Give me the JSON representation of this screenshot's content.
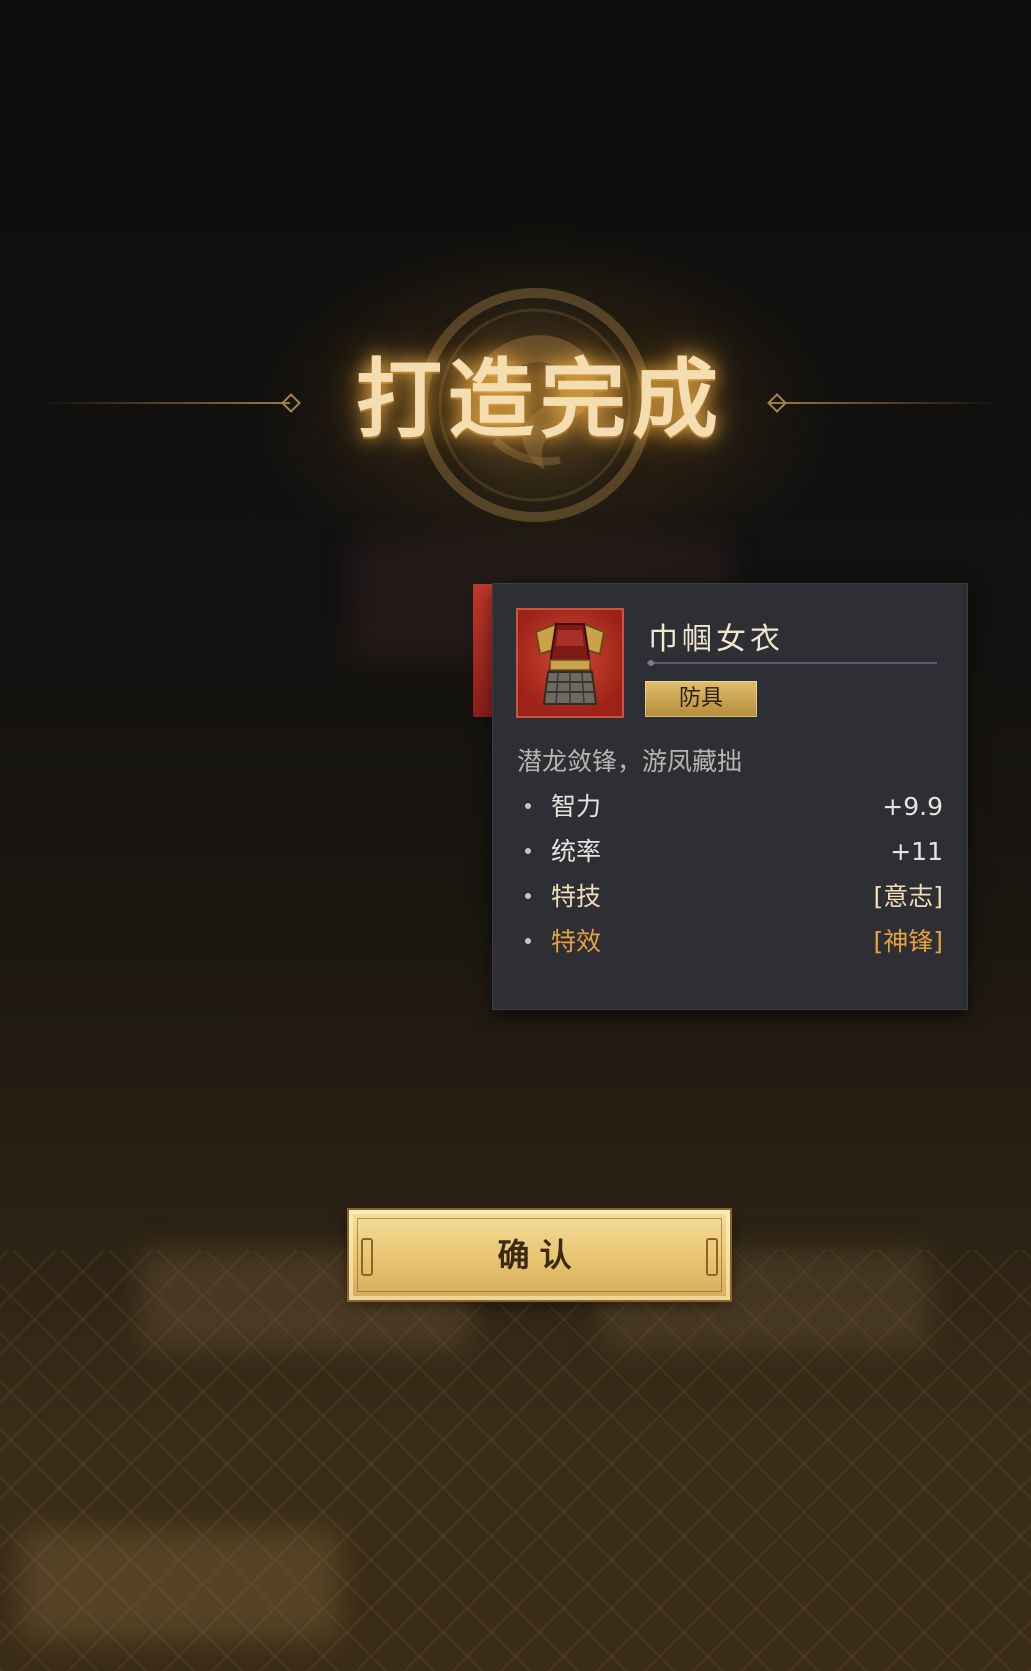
{
  "dialog": {
    "title": "打造完成",
    "confirm_label": "确认"
  },
  "item": {
    "name": "巾帼女衣",
    "type": "防具",
    "flavor": "潜龙敛锋，游凤藏拙",
    "stats": [
      {
        "label": "智力",
        "value": "+9.9"
      },
      {
        "label": "统率",
        "value": "+11"
      },
      {
        "label": "特技",
        "value": "[意志]"
      },
      {
        "label": "特效",
        "value": "[神锋]"
      }
    ]
  },
  "colors": {
    "gold_glow": "#f4ddb0",
    "card_bg": "#2e2f34",
    "rarity_red": "#c2382c",
    "badge_gold": "#d6ab58",
    "effect_orange": "#e5a040"
  },
  "icons": {
    "emblem": "dragon-emblem-icon",
    "item": "armor-vest-icon"
  }
}
